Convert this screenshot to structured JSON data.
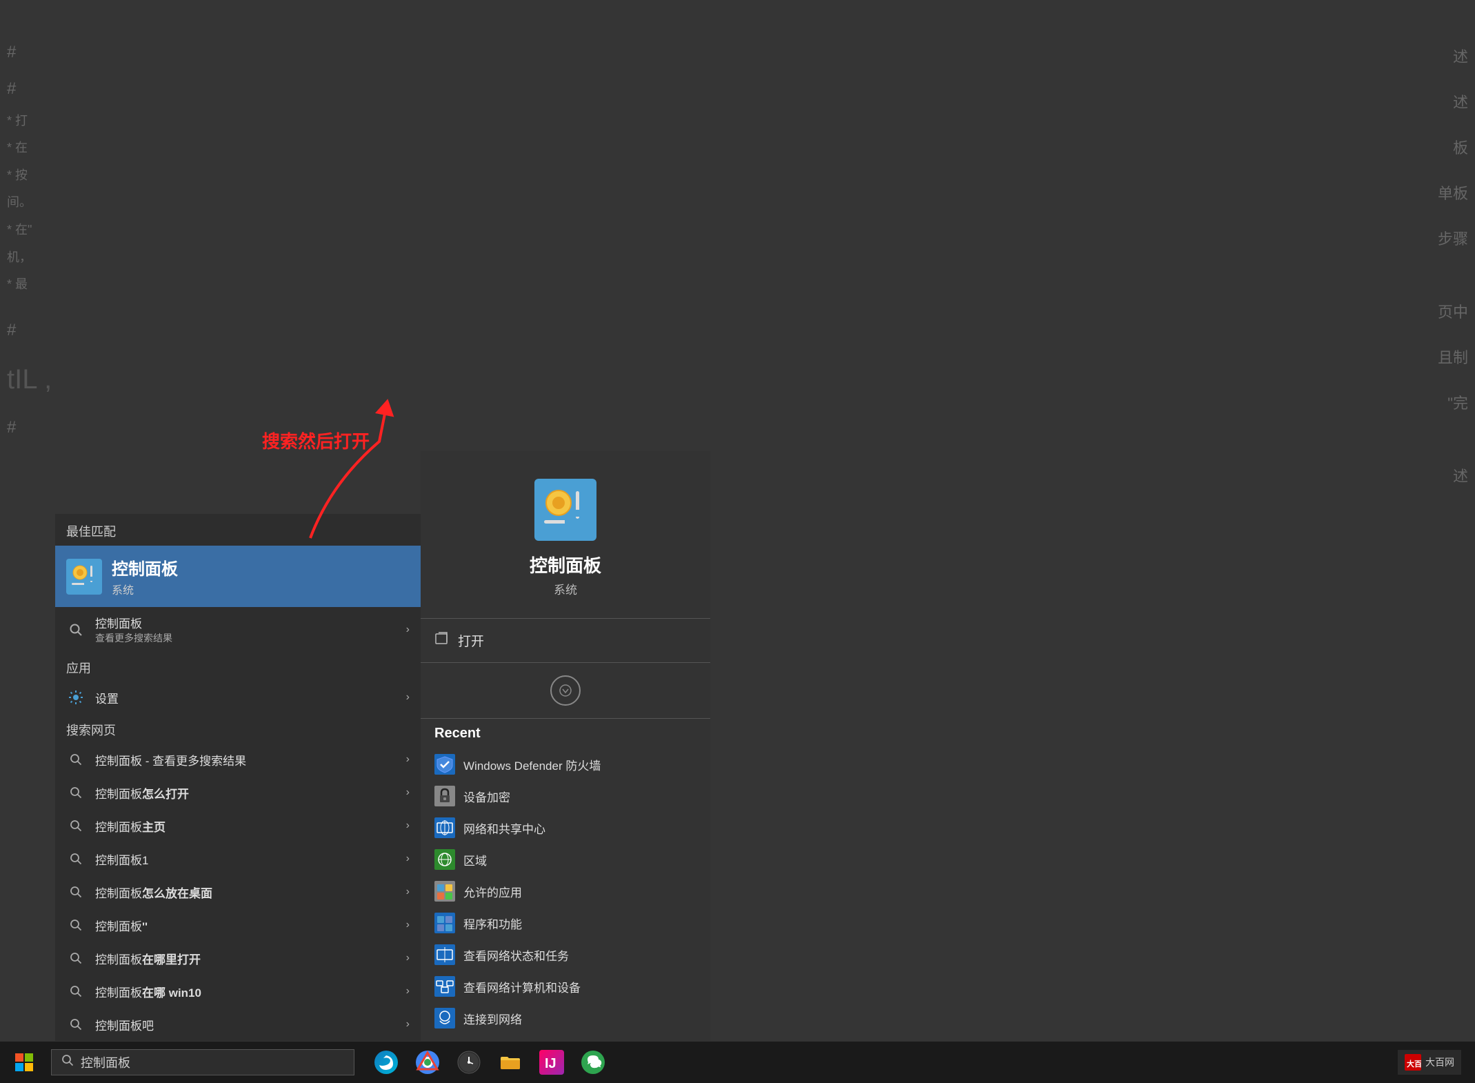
{
  "background": {
    "color": "#1a1a1a"
  },
  "doc_left_hints": [
    "#",
    "#",
    "*",
    "*",
    "*",
    "*",
    "*",
    "#",
    "#"
  ],
  "doc_right_hints": [
    "述",
    "述",
    "板",
    "完",
    "述"
  ],
  "search_panel": {
    "best_match_label": "最佳匹配",
    "best_match": {
      "title": "控制面板",
      "subtitle": "系统",
      "icon": "control-panel-icon"
    },
    "more_search_item": {
      "text": "控制面板",
      "subtext": "查看更多搜索结果",
      "arrow": "›"
    },
    "apps_section_label": "应用",
    "apps": [
      {
        "text": "设置",
        "arrow": "›",
        "icon": "gear"
      }
    ],
    "web_section_label": "搜索网页",
    "web_items": [
      {
        "text": "控制面板 - 查看更多搜索结果",
        "arrow": "›"
      },
      {
        "text1": "控制面板",
        "text2": "怎么打开",
        "arrow": "›"
      },
      {
        "text1": "控制面板",
        "text2": "主页",
        "arrow": "›"
      },
      {
        "text": "控制面板1",
        "arrow": "›"
      },
      {
        "text1": "控制面板",
        "text2": "怎么放在桌面",
        "arrow": "›"
      },
      {
        "text1": "控制面板",
        "text2": "''",
        "arrow": "›"
      },
      {
        "text1": "控制面板",
        "text2": "在哪里打开",
        "arrow": "›"
      },
      {
        "text1": "控制面板",
        "text2": "在哪 win10",
        "arrow": "›"
      },
      {
        "text": "控制面板吧",
        "arrow": "›"
      }
    ]
  },
  "right_panel": {
    "app_title": "控制面板",
    "app_subtitle": "系统",
    "open_label": "打开",
    "recent_label": "Recent",
    "recent_items": [
      {
        "text": "Windows Defender 防火墙",
        "icon": "shield-icon"
      },
      {
        "text": "设备加密",
        "icon": "lock-icon"
      },
      {
        "text": "网络和共享中心",
        "icon": "network-icon"
      },
      {
        "text": "区域",
        "icon": "globe-icon"
      },
      {
        "text": "允许的应用",
        "icon": "app-icon"
      },
      {
        "text": "程序和功能",
        "icon": "program-icon"
      },
      {
        "text": "查看网络状态和任务",
        "icon": "network2-icon"
      },
      {
        "text": "查看网络计算机和设备",
        "icon": "network3-icon"
      },
      {
        "text": "连接到网络",
        "icon": "connect-icon"
      }
    ]
  },
  "annotation": {
    "text": "搜索然后打开"
  },
  "taskbar": {
    "search_text": "控制面板",
    "search_placeholder": "控制面板",
    "apps": [
      "edge-icon",
      "chrome-icon",
      "clock-icon",
      "folder-icon",
      "intellij-icon",
      "wechat-icon"
    ],
    "corner_label": "大百网"
  }
}
